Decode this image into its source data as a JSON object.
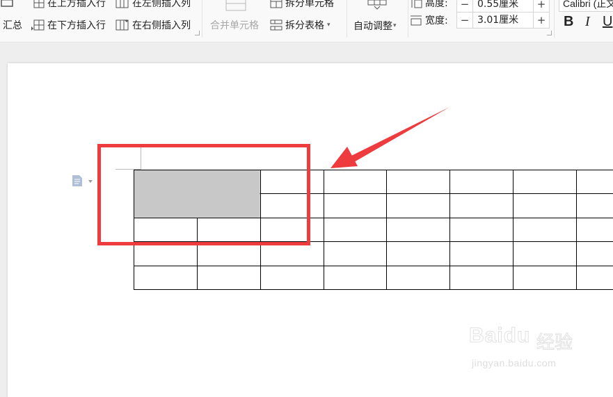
{
  "ribbon": {
    "summary_label": "汇总",
    "insert_row_above": "在上方插入行",
    "insert_row_below": "在下方插入行",
    "insert_col_left": "在左侧插入列",
    "insert_col_right": "在右侧插入列",
    "merge_cells": "合并单元格",
    "split_cells": "拆分单元格",
    "split_table": "拆分表格",
    "auto_fit": "自动调整",
    "height_label": "高度:",
    "height_value": "0.55厘米",
    "width_label": "宽度:",
    "width_value": "3.01厘米",
    "minus": "−",
    "plus": "+",
    "font_name": "Calibri (正文)",
    "bold": "B",
    "italic": "I",
    "underline": "U"
  },
  "table": {
    "rows": 5,
    "cols": 8,
    "merged_cell": {
      "row_span": 2,
      "col_span": 2,
      "fill": "#c8c8c8"
    },
    "border_color": "#000000"
  },
  "annotation": {
    "highlight_color": "#ee3b3e"
  },
  "watermark": {
    "brand": "Baidu",
    "brand_cn": "经验",
    "url": "jingyan.baidu.com"
  }
}
